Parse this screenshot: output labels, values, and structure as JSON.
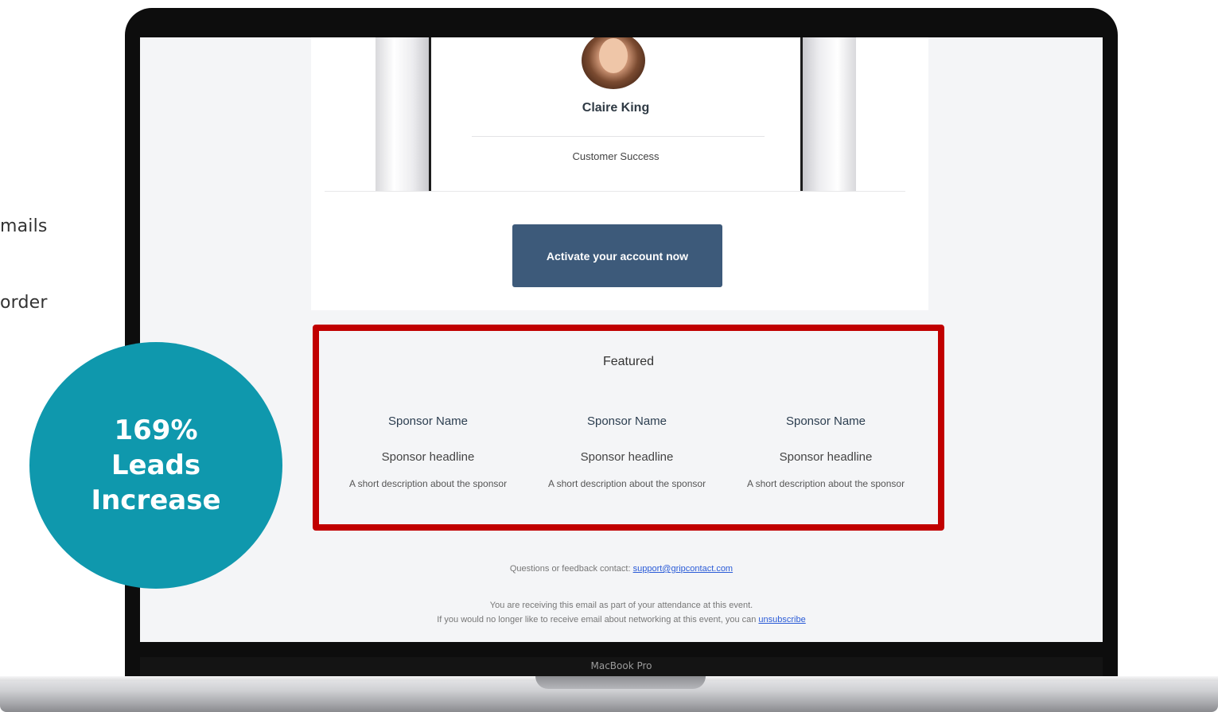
{
  "side_text": {
    "line1": "mails",
    "line2": "order"
  },
  "email": {
    "person": {
      "name": "Claire King",
      "role": "Customer Success"
    },
    "cta_label": "Activate your account now",
    "featured": {
      "title": "Featured",
      "sponsors": [
        {
          "name": "Sponsor Name",
          "headline": "Sponsor headline",
          "description": "A short description about the sponsor"
        },
        {
          "name": "Sponsor Name",
          "headline": "Sponsor headline",
          "description": "A short description about the sponsor"
        },
        {
          "name": "Sponsor Name",
          "headline": "Sponsor headline",
          "description": "A short description about the sponsor"
        }
      ]
    },
    "footer": {
      "contact_prefix": "Questions or feedback contact:",
      "contact_email": "support@gripcontact.com",
      "line2": "You are receiving this email as part of your attendance at this event.",
      "line3_prefix": "If you would no longer like to receive email about networking at this event, you can",
      "unsubscribe": "unsubscribe"
    }
  },
  "device_label": "MacBook Pro",
  "badge": {
    "line1": "169%",
    "line2": "Leads",
    "line3": "Increase"
  },
  "colors": {
    "badge": "#0f98ad",
    "cta": "#3d5a7a",
    "highlight": "#c10000"
  }
}
